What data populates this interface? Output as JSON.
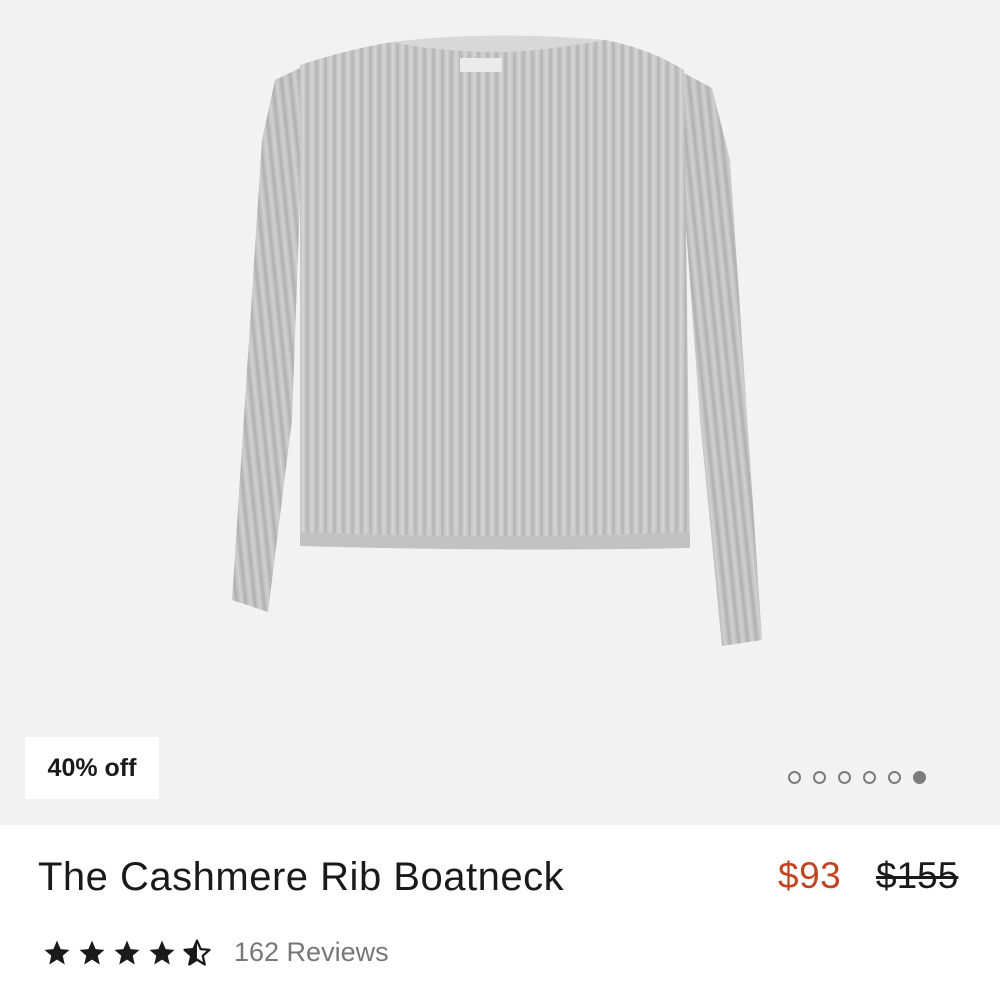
{
  "product": {
    "image_alt": "Grey ribbed cashmere boatneck sweater",
    "discount_badge": "40% off",
    "carousel": {
      "total": 6,
      "active_index": 5
    },
    "title": "The Cashmere Rib Boatneck",
    "sale_price": "$93",
    "original_price": "$155",
    "rating": {
      "value": 4.5,
      "max": 5
    },
    "reviews_label": "162 Reviews"
  },
  "colors": {
    "hero_background": "#f2f2f2",
    "sale_price": "#c24522",
    "sweater": "#c8c8c8"
  },
  "icons": [
    "star-filled-icon",
    "star-half-icon"
  ]
}
